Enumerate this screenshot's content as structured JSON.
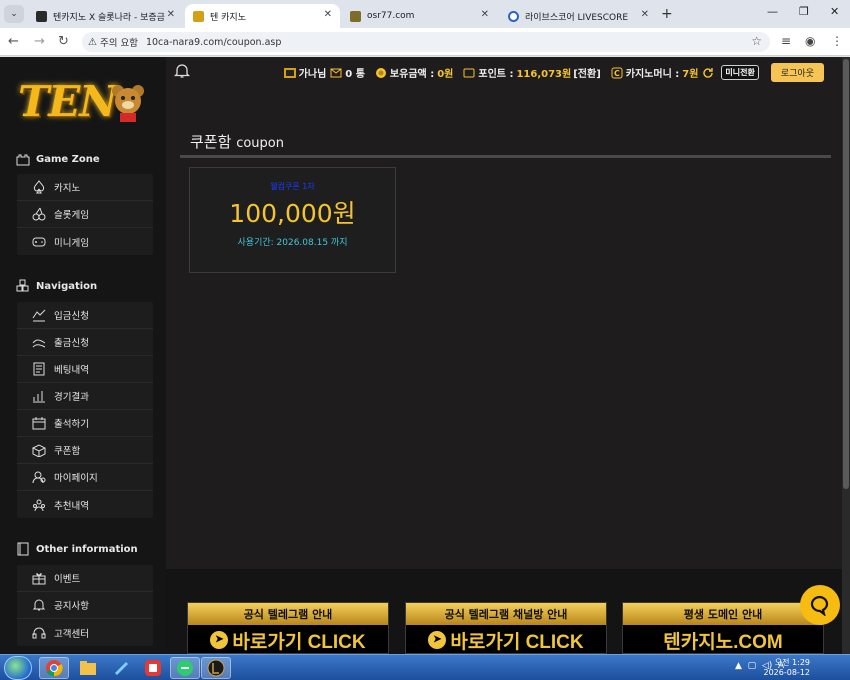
{
  "browser": {
    "tabs": [
      {
        "label": "텐카지노 X 슬롯나라 - 보증금"
      },
      {
        "label": "텐 카지노"
      },
      {
        "label": "osr77.com"
      },
      {
        "label": "라이브스코어 LIVESCORE"
      }
    ],
    "security_label": "주의 요함",
    "url": "10ca-nara9.com/coupon.asp"
  },
  "sidebar": {
    "logo_text": "TEN",
    "sections": [
      {
        "title": "Game Zone",
        "items": [
          {
            "label": "카지노",
            "icon": "spade-icon"
          },
          {
            "label": "슬롯게임",
            "icon": "cherry-icon"
          },
          {
            "label": "미니게임",
            "icon": "gamepad-icon"
          }
        ]
      },
      {
        "title": "Navigation",
        "items": [
          {
            "label": "입금신청",
            "icon": "deposit-icon"
          },
          {
            "label": "출금신청",
            "icon": "withdraw-icon"
          },
          {
            "label": "베팅내역",
            "icon": "betting-history-icon"
          },
          {
            "label": "경기결과",
            "icon": "chart-icon"
          },
          {
            "label": "출석하기",
            "icon": "calendar-icon"
          },
          {
            "label": "쿠폰함",
            "icon": "gift-box-icon"
          },
          {
            "label": "마이페이지",
            "icon": "user-icon"
          },
          {
            "label": "추천내역",
            "icon": "users-icon"
          }
        ]
      },
      {
        "title": "Other information",
        "items": [
          {
            "label": "이벤트",
            "icon": "gift-icon"
          },
          {
            "label": "공지사항",
            "icon": "bell-icon"
          },
          {
            "label": "고객센터",
            "icon": "headset-icon"
          }
        ]
      }
    ]
  },
  "header": {
    "username": "가나님",
    "messages": "0 통",
    "balance_label": "보유금액 :",
    "balance": "0원",
    "points_label": "포인트 :",
    "points": "116,073원",
    "convert_label": "[전환]",
    "casino_money_label": "카지노머니 :",
    "casino_money": "7원",
    "mini_convert": "미니전환",
    "logout": "로그아웃"
  },
  "page": {
    "title": "쿠폰함",
    "title_en": "coupon"
  },
  "coupon": {
    "name": "웰컴쿠폰 1차",
    "amount": "100,000원",
    "period": "사용기간: 2026.08.15 까지"
  },
  "banners": [
    {
      "head": "공식 텔레그램 안내",
      "body": "바로가기 CLICK"
    },
    {
      "head": "공식 텔레그램 채널방 안내",
      "body": "바로가기 CLICK"
    },
    {
      "head": "평생 도메인 안내",
      "body": "텐카지노.COM"
    }
  ],
  "taskbar": {
    "time": "오전 1:29",
    "date": "2026-08-12",
    "lang": "A"
  },
  "colors": {
    "accent_gold": "#f4c430",
    "coupon_name": "#1a3cff",
    "coupon_period": "#43c6d8",
    "logout_bg": "#f6c455"
  }
}
